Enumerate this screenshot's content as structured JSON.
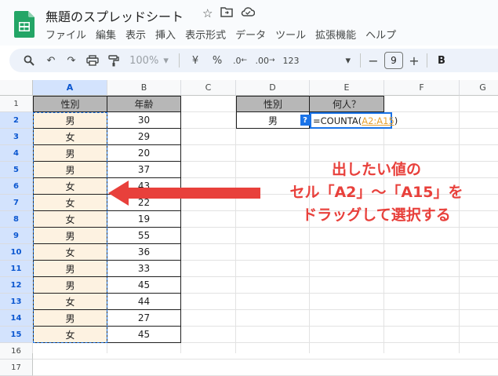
{
  "app": {
    "title": "無題のスプレッドシート",
    "menu": [
      "ファイル",
      "編集",
      "表示",
      "挿入",
      "表示形式",
      "データ",
      "ツール",
      "拡張機能",
      "ヘルプ"
    ]
  },
  "toolbar": {
    "zoom": "100%",
    "currency": "¥",
    "percent": "%",
    "decrease_decimal": ".0",
    "increase_decimal": ".00",
    "number_format": "123",
    "font_size": "9",
    "minus": "−",
    "plus": "+",
    "bold": "B"
  },
  "columns": [
    "A",
    "B",
    "C",
    "D",
    "E",
    "F",
    "G"
  ],
  "rows": [
    "1",
    "2",
    "3",
    "4",
    "5",
    "6",
    "7",
    "8",
    "9",
    "10",
    "11",
    "12",
    "13",
    "14",
    "15",
    "16",
    "17"
  ],
  "table": {
    "headers": [
      "性別",
      "年齢"
    ],
    "data": [
      [
        "男",
        "30"
      ],
      [
        "女",
        "29"
      ],
      [
        "男",
        "20"
      ],
      [
        "男",
        "37"
      ],
      [
        "女",
        "43"
      ],
      [
        "女",
        "22"
      ],
      [
        "女",
        "19"
      ],
      [
        "男",
        "55"
      ],
      [
        "女",
        "36"
      ],
      [
        "男",
        "33"
      ],
      [
        "男",
        "45"
      ],
      [
        "女",
        "44"
      ],
      [
        "男",
        "27"
      ],
      [
        "女",
        "45"
      ]
    ]
  },
  "count_table": {
    "headers": [
      "性別",
      "何人？"
    ],
    "criteria": "男",
    "hint": "?",
    "formula_prefix": "=COUNTA(",
    "formula_ref": "A2:A15",
    "formula_suffix": ")"
  },
  "annotation": {
    "line1": "出したい値の",
    "line2": "セル「A2」～「A15」を",
    "line3": "ドラッグして選択する",
    "color": "#e8403b"
  }
}
